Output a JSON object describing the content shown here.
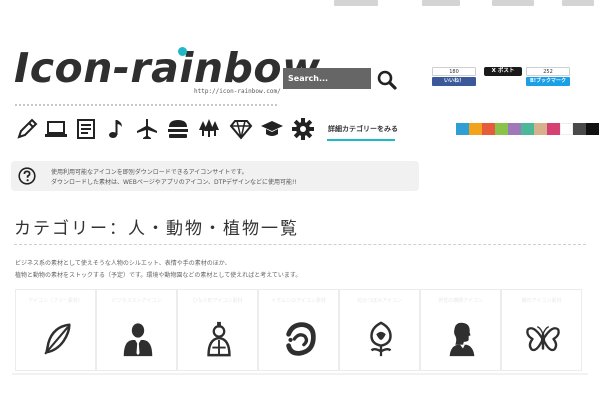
{
  "header": {
    "logo_text": "Icon-rainbow",
    "logo_url": "http://icon-rainbow.com/",
    "search_placeholder": "Search...",
    "brand_color": "#1fb8c6"
  },
  "share": {
    "facebook": {
      "count": "180",
      "label": "いいね！",
      "color": "#3b5998"
    },
    "x": {
      "label": "X ポスト"
    },
    "hatena": {
      "count": "252",
      "label": "B!ブックマーク",
      "color": "#1aa0e6"
    }
  },
  "categories": {
    "icons": [
      "pencil-icon",
      "laptop-icon",
      "document-icon",
      "music-note-icon",
      "airplane-icon",
      "hamburger-icon",
      "trees-icon",
      "diamond-icon",
      "graduation-cap-icon",
      "gear-icon"
    ],
    "detail_label": "詳細カテゴリーをみる"
  },
  "color_swatches": [
    "#2e9fd6",
    "#f2a31c",
    "#e65b3c",
    "#8ac34a",
    "#a07ab8",
    "#4cb89a",
    "#d7b18d",
    "#d64173",
    "#ffffff",
    "#4a4a4a",
    "#111111"
  ],
  "notice": {
    "line1": "使用利用可能なアイコンを即別ダウンロードできるアイコンサイトです。",
    "line2": "ダウンロードした素材は、WEBページやアプリのアイコン、DTPデザインなどに使用可能!!"
  },
  "page": {
    "title": "カテゴリー：人・動物・植物一覧",
    "desc_line1": "ビジネス系の素材として使えそうな人物のシルエット、表情や手の素材のほか、",
    "desc_line2": "植物と動物の素材をストックする（予定）です。環境や動物園などの素材として使えればと考えています。"
  },
  "cards": [
    {
      "icon": "feather-icon",
      "label": "アイコン（フリー素材）"
    },
    {
      "icon": "businessman-icon",
      "label": "ビジネスマンアイコン"
    },
    {
      "icon": "hina-doll-icon",
      "label": "ひな人形アイコン素材"
    },
    {
      "icon": "grub-icon",
      "label": "イモムシのアイコン素材"
    },
    {
      "icon": "flower-bud-icon",
      "label": "花のつぼみアイコン"
    },
    {
      "icon": "man-profile-icon",
      "label": "男性の横顔アイコン"
    },
    {
      "icon": "butterfly-icon",
      "label": "蝶のアイコン素材"
    }
  ]
}
